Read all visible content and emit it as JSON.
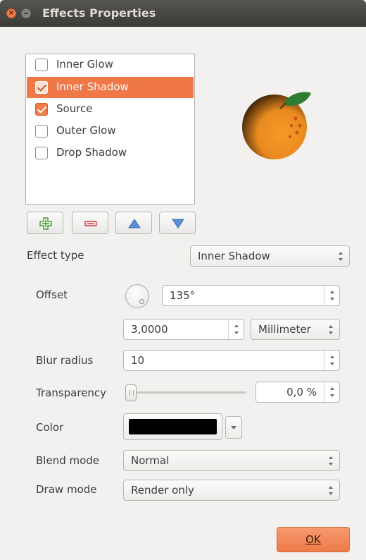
{
  "window": {
    "title": "Effects Properties"
  },
  "effects": [
    {
      "label": "Inner Glow",
      "checked": false,
      "selected": false
    },
    {
      "label": "Inner Shadow",
      "checked": true,
      "selected": true
    },
    {
      "label": "Source",
      "checked": true,
      "selected": false
    },
    {
      "label": "Outer Glow",
      "checked": false,
      "selected": false
    },
    {
      "label": "Drop Shadow",
      "checked": false,
      "selected": false
    }
  ],
  "toolbar": {
    "add_icon": "plus-icon",
    "remove_icon": "minus-icon",
    "up_icon": "arrow-up-icon",
    "down_icon": "arrow-down-icon"
  },
  "form": {
    "effect_type_label": "Effect type",
    "effect_type_value": "Inner Shadow",
    "offset_label": "Offset",
    "offset_angle": "135°",
    "offset_distance": "3,0000",
    "offset_unit": "Millimeter",
    "blur_radius_label": "Blur radius",
    "blur_radius_value": "10",
    "transparency_label": "Transparency",
    "transparency_value": "0,0 %",
    "transparency_fraction": 0,
    "color_label": "Color",
    "color_value": "#000000",
    "blend_mode_label": "Blend mode",
    "blend_mode_value": "Normal",
    "draw_mode_label": "Draw mode",
    "draw_mode_value": "Render only"
  },
  "buttons": {
    "ok": "OK"
  },
  "colors": {
    "accent": "#f07746",
    "titlebar": "#3c3b37"
  }
}
